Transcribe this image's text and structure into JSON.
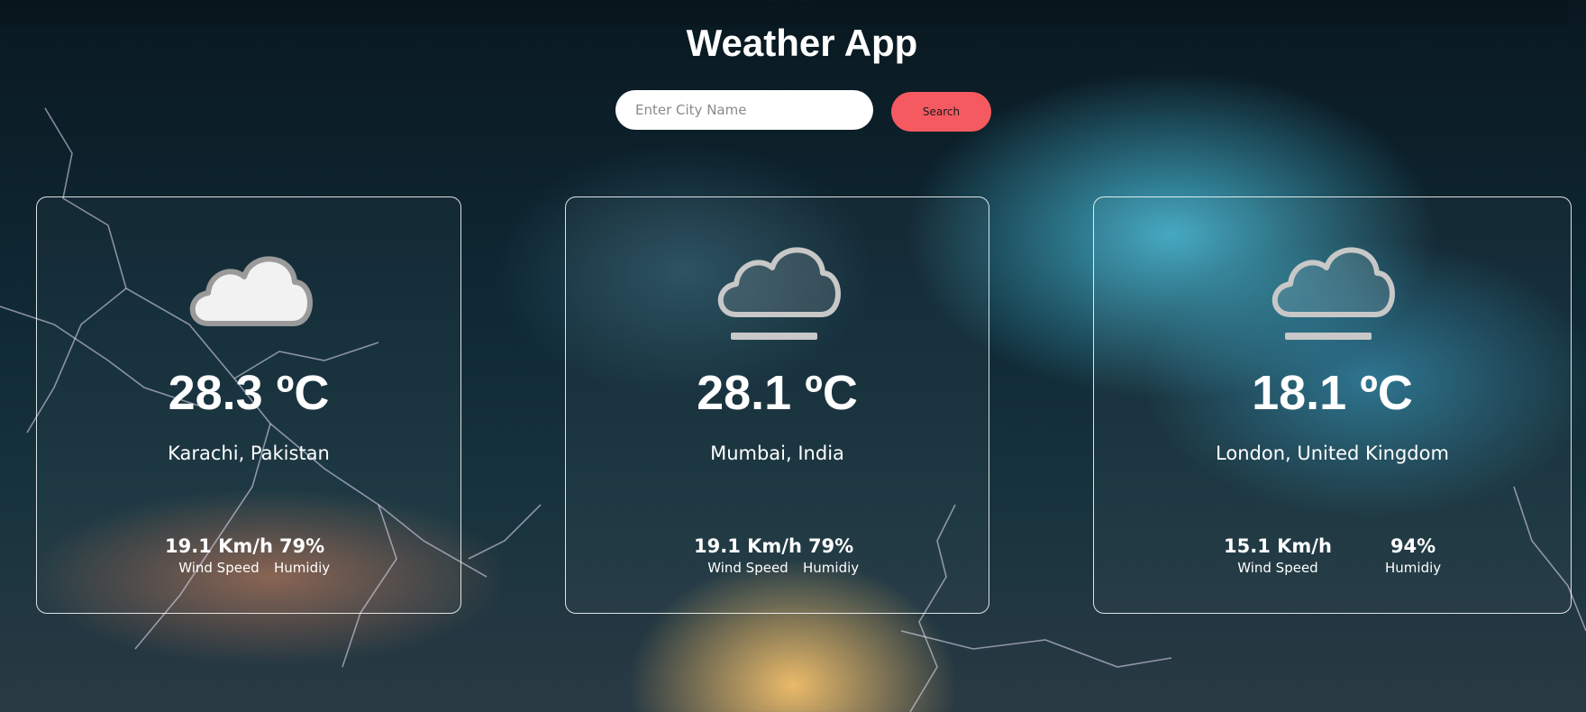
{
  "app": {
    "title": "Weather App"
  },
  "search": {
    "placeholder": "Enter City Name",
    "value": "",
    "button_label": "Search"
  },
  "cards": [
    {
      "icon": "cloud-icon",
      "temperature": "28.3 ºC",
      "location": "Karachi, Pakistan",
      "wind_value": "19.1 Km/h",
      "wind_label": "Wind Speed",
      "humidity_value": "79%",
      "humidity_label": "Humidiy"
    },
    {
      "icon": "fog-cloud-icon",
      "temperature": "28.1 ºC",
      "location": "Mumbai, India",
      "wind_value": "19.1 Km/h",
      "wind_label": "Wind Speed",
      "humidity_value": "79%",
      "humidity_label": "Humidiy"
    },
    {
      "icon": "fog-cloud-icon",
      "temperature": "18.1 ºC",
      "location": "London, United Kingdom",
      "wind_value": "15.1 Km/h",
      "wind_label": "Wind Speed",
      "humidity_value": "94%",
      "humidity_label": "Humidiy"
    }
  ],
  "colors": {
    "button": "#f45a60",
    "card_border": "#ffffff"
  }
}
